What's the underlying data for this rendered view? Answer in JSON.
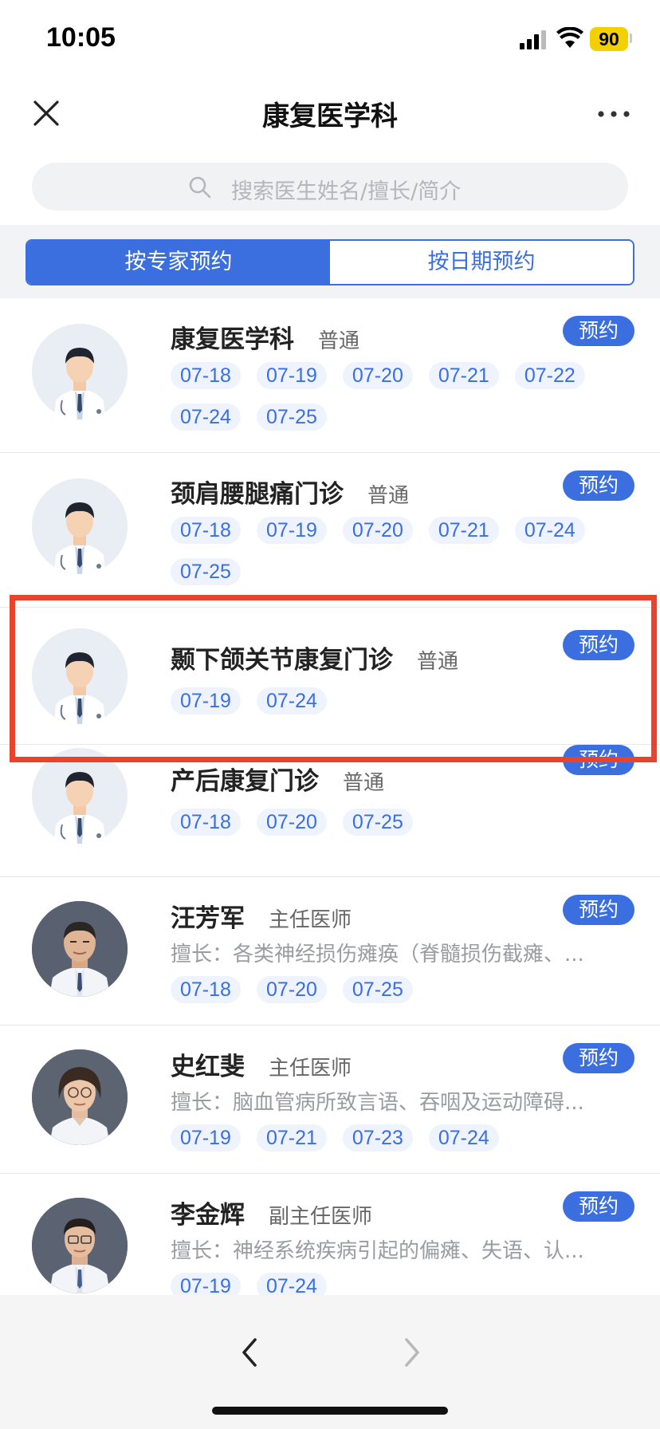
{
  "status_bar": {
    "time": "10:05",
    "battery": "90"
  },
  "nav": {
    "title": "康复医学科"
  },
  "search": {
    "placeholder": "搜索医生姓名/擅长/简介"
  },
  "tabs": [
    {
      "label": "按专家预约",
      "active": true
    },
    {
      "label": "按日期预约",
      "active": false
    }
  ],
  "book_label": "预约",
  "specialty_prefix": "擅长：",
  "items": [
    {
      "name": "康复医学科",
      "title": "普通",
      "specialty": "",
      "avatar": "generic-doctor",
      "dates": [
        "07-18",
        "07-19",
        "07-20",
        "07-21",
        "07-22",
        "07-24",
        "07-25"
      ]
    },
    {
      "name": "颈肩腰腿痛门诊",
      "title": "普通",
      "specialty": "",
      "avatar": "generic-doctor",
      "dates": [
        "07-18",
        "07-19",
        "07-20",
        "07-21",
        "07-24",
        "07-25"
      ]
    },
    {
      "name": "颞下颌关节康复门诊",
      "title": "普通",
      "specialty": "",
      "avatar": "generic-doctor",
      "dates": [
        "07-19",
        "07-24"
      ]
    },
    {
      "name": "产后康复门诊",
      "title": "普通",
      "specialty": "",
      "avatar": "generic-doctor",
      "dates": [
        "07-18",
        "07-20",
        "07-25"
      ]
    },
    {
      "name": "汪芳军",
      "title": "主任医师",
      "specialty": "擅长：各类神经损伤瘫痪（脊髓损伤截瘫、...",
      "avatar": "photo",
      "dates": [
        "07-18",
        "07-20",
        "07-25"
      ]
    },
    {
      "name": "史红斐",
      "title": "主任医师",
      "specialty": "擅长：脑血管病所致言语、吞咽及运动障碍...",
      "avatar": "photo",
      "dates": [
        "07-19",
        "07-21",
        "07-23",
        "07-24"
      ]
    },
    {
      "name": "李金辉",
      "title": "副主任医师",
      "specialty": "擅长：神经系统疾病引起的偏瘫、失语、认...",
      "avatar": "photo",
      "dates": [
        "07-19",
        "07-24"
      ]
    }
  ],
  "colors": {
    "accent": "#3b6fe0",
    "highlight": "#e8432c",
    "chip_bg": "#eef3fd"
  }
}
